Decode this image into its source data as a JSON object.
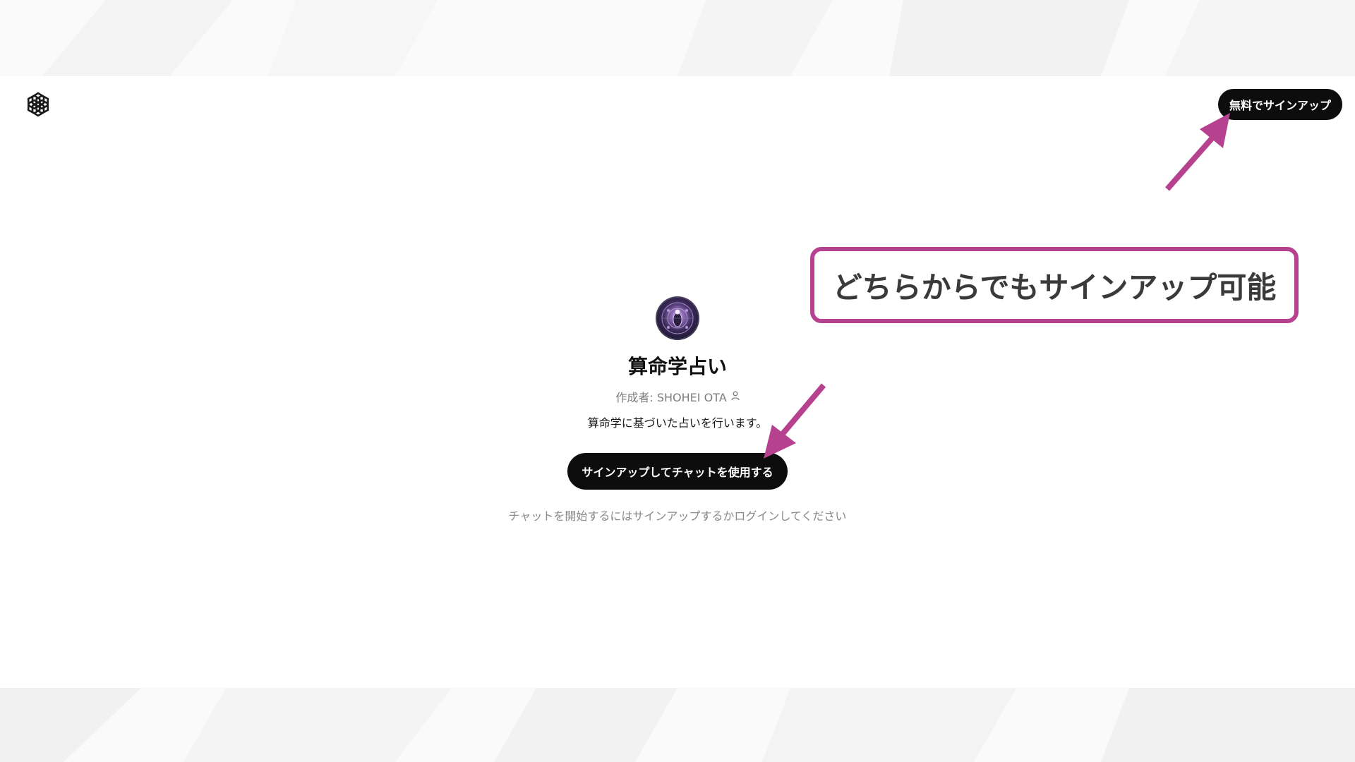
{
  "header": {
    "logo_icon": "openai-logo-icon",
    "signup_button_label": "無料でサインアップ"
  },
  "gpt": {
    "avatar_icon": "mandala-avatar-icon",
    "title": "算命学占い",
    "author_label": "作成者: SHOHEI OTA",
    "author_icon": "person-icon",
    "description": "算命学に基づいた占いを行います。",
    "signup_chat_label": "サインアップしてチャットを使用する",
    "hint": "チャットを開始するにはサインアップするかログインしてください"
  },
  "annotation": {
    "callout_text": "どちらからでもサインアップ可能",
    "accent_color": "#b5418f",
    "arrow_icon": "pointer-arrow-icon"
  }
}
